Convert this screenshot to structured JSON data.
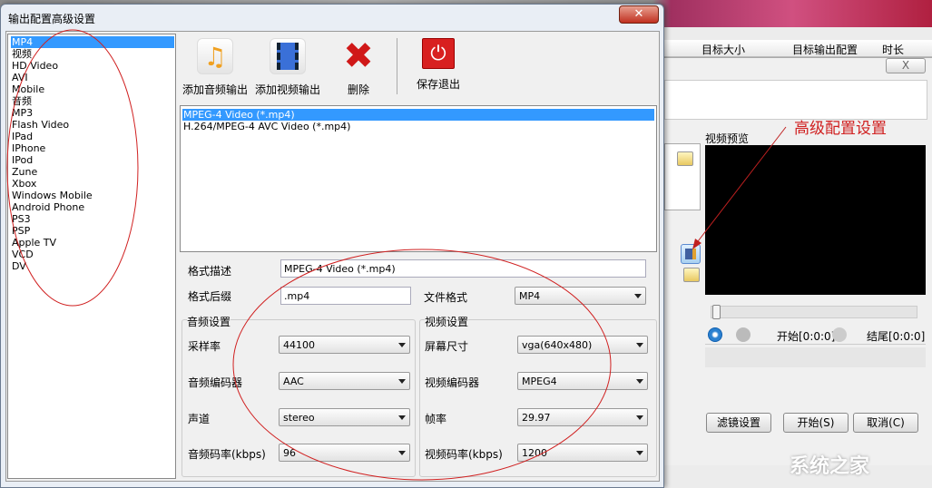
{
  "background_app": {
    "columns": [
      "目标大小",
      "目标输出配置",
      "时长"
    ],
    "close_label": "X",
    "preview_label": "视频预览",
    "start_time": "开始[0:0:0]",
    "end_time": "结尾[0:0:0]",
    "buttons": {
      "filter": "滤镜设置",
      "start": "开始(S)",
      "cancel": "取消(C)"
    },
    "annotation": "高级配置设置",
    "watermark": "系统之家"
  },
  "dialog": {
    "title": "输出配置高级设置",
    "close_label": "✕",
    "profiles": [
      "MP4",
      "视频",
      "HD Video",
      "AVI",
      "Mobile",
      "音频",
      "MP3",
      "Flash Video",
      "IPad",
      "IPhone",
      "IPod",
      "Zune",
      "Xbox",
      "Windows Mobile",
      "Android Phone",
      "PS3",
      "PSP",
      "Apple TV",
      "VCD",
      "DV"
    ],
    "selected_profile": 0,
    "toolbar": [
      {
        "label": "添加音频输出",
        "icon": "music-note-icon"
      },
      {
        "label": "添加视频输出",
        "icon": "film-icon"
      },
      {
        "label": "删除",
        "icon": "delete-x-icon"
      },
      {
        "label": "保存退出",
        "icon": "power-icon"
      }
    ],
    "formats": [
      "MPEG-4 Video (*.mp4)",
      "H.264/MPEG-4 AVC Video (*.mp4)"
    ],
    "selected_format": 0,
    "desc_label": "格式描述",
    "desc_value": "MPEG-4 Video (*.mp4)",
    "suffix_label": "格式后缀",
    "suffix_value": ".mp4",
    "file_format_label": "文件格式",
    "file_format_value": "MP4",
    "audio": {
      "title": "音频设置",
      "sample_rate_label": "采样率",
      "sample_rate": "44100",
      "codec_label": "音频编码器",
      "codec": "AAC",
      "channel_label": "声道",
      "channel": "stereo",
      "bitrate_label": "音频码率(kbps)",
      "bitrate": "96"
    },
    "video": {
      "title": "视频设置",
      "size_label": "屏幕尺寸",
      "size": "vga(640x480)",
      "codec_label": "视频编码器",
      "codec": "MPEG4",
      "fps_label": "帧率",
      "fps": "29.97",
      "bitrate_label": "视频码率(kbps)",
      "bitrate": "1200"
    }
  },
  "colors": {
    "selection": "#3399ff",
    "annotation": "#d02020"
  }
}
